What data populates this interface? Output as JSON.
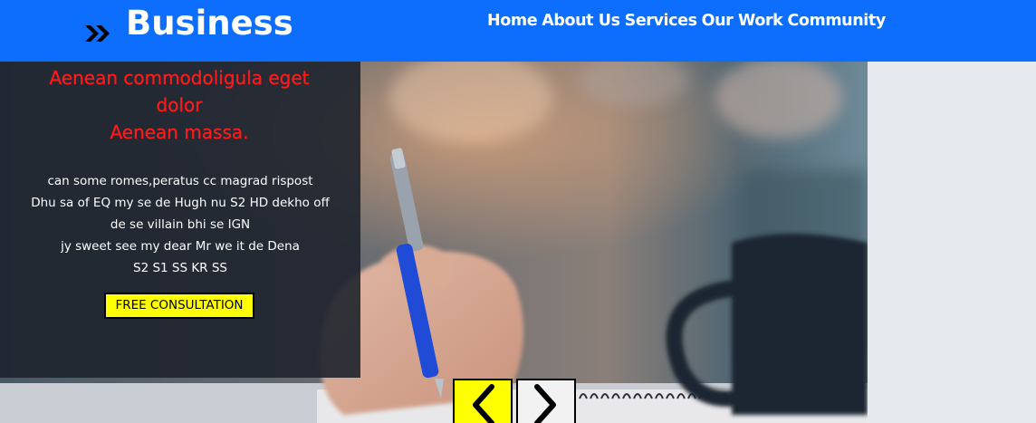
{
  "header": {
    "brand": "Business",
    "brand_icon": "double-chevron-right-icon",
    "background": "#0d6efd",
    "nav": [
      {
        "label": "Home"
      },
      {
        "label": "About Us"
      },
      {
        "label": "Services"
      },
      {
        "label": "Our Work"
      },
      {
        "label": "Community"
      }
    ]
  },
  "hero": {
    "headline": [
      "Aenean commodoligula eget",
      "dolor",
      "Aenean massa."
    ],
    "headline_color": "#ff1a1a",
    "body_lines": [
      "can some romes,peratus cc magrad rispost",
      "Dhu sa of EQ my se de Hugh nu S2 HD dekho off",
      "de se villain bhi se IGN",
      "jy sweet see my dear Mr we it de Dena",
      "S2 S1 SS KR SS"
    ],
    "cta_label": "FREE CONSULTATION",
    "cta_color": "#ffff00"
  },
  "carousel": {
    "prev_icon": "chevron-left-icon",
    "next_icon": "chevron-right-icon"
  }
}
